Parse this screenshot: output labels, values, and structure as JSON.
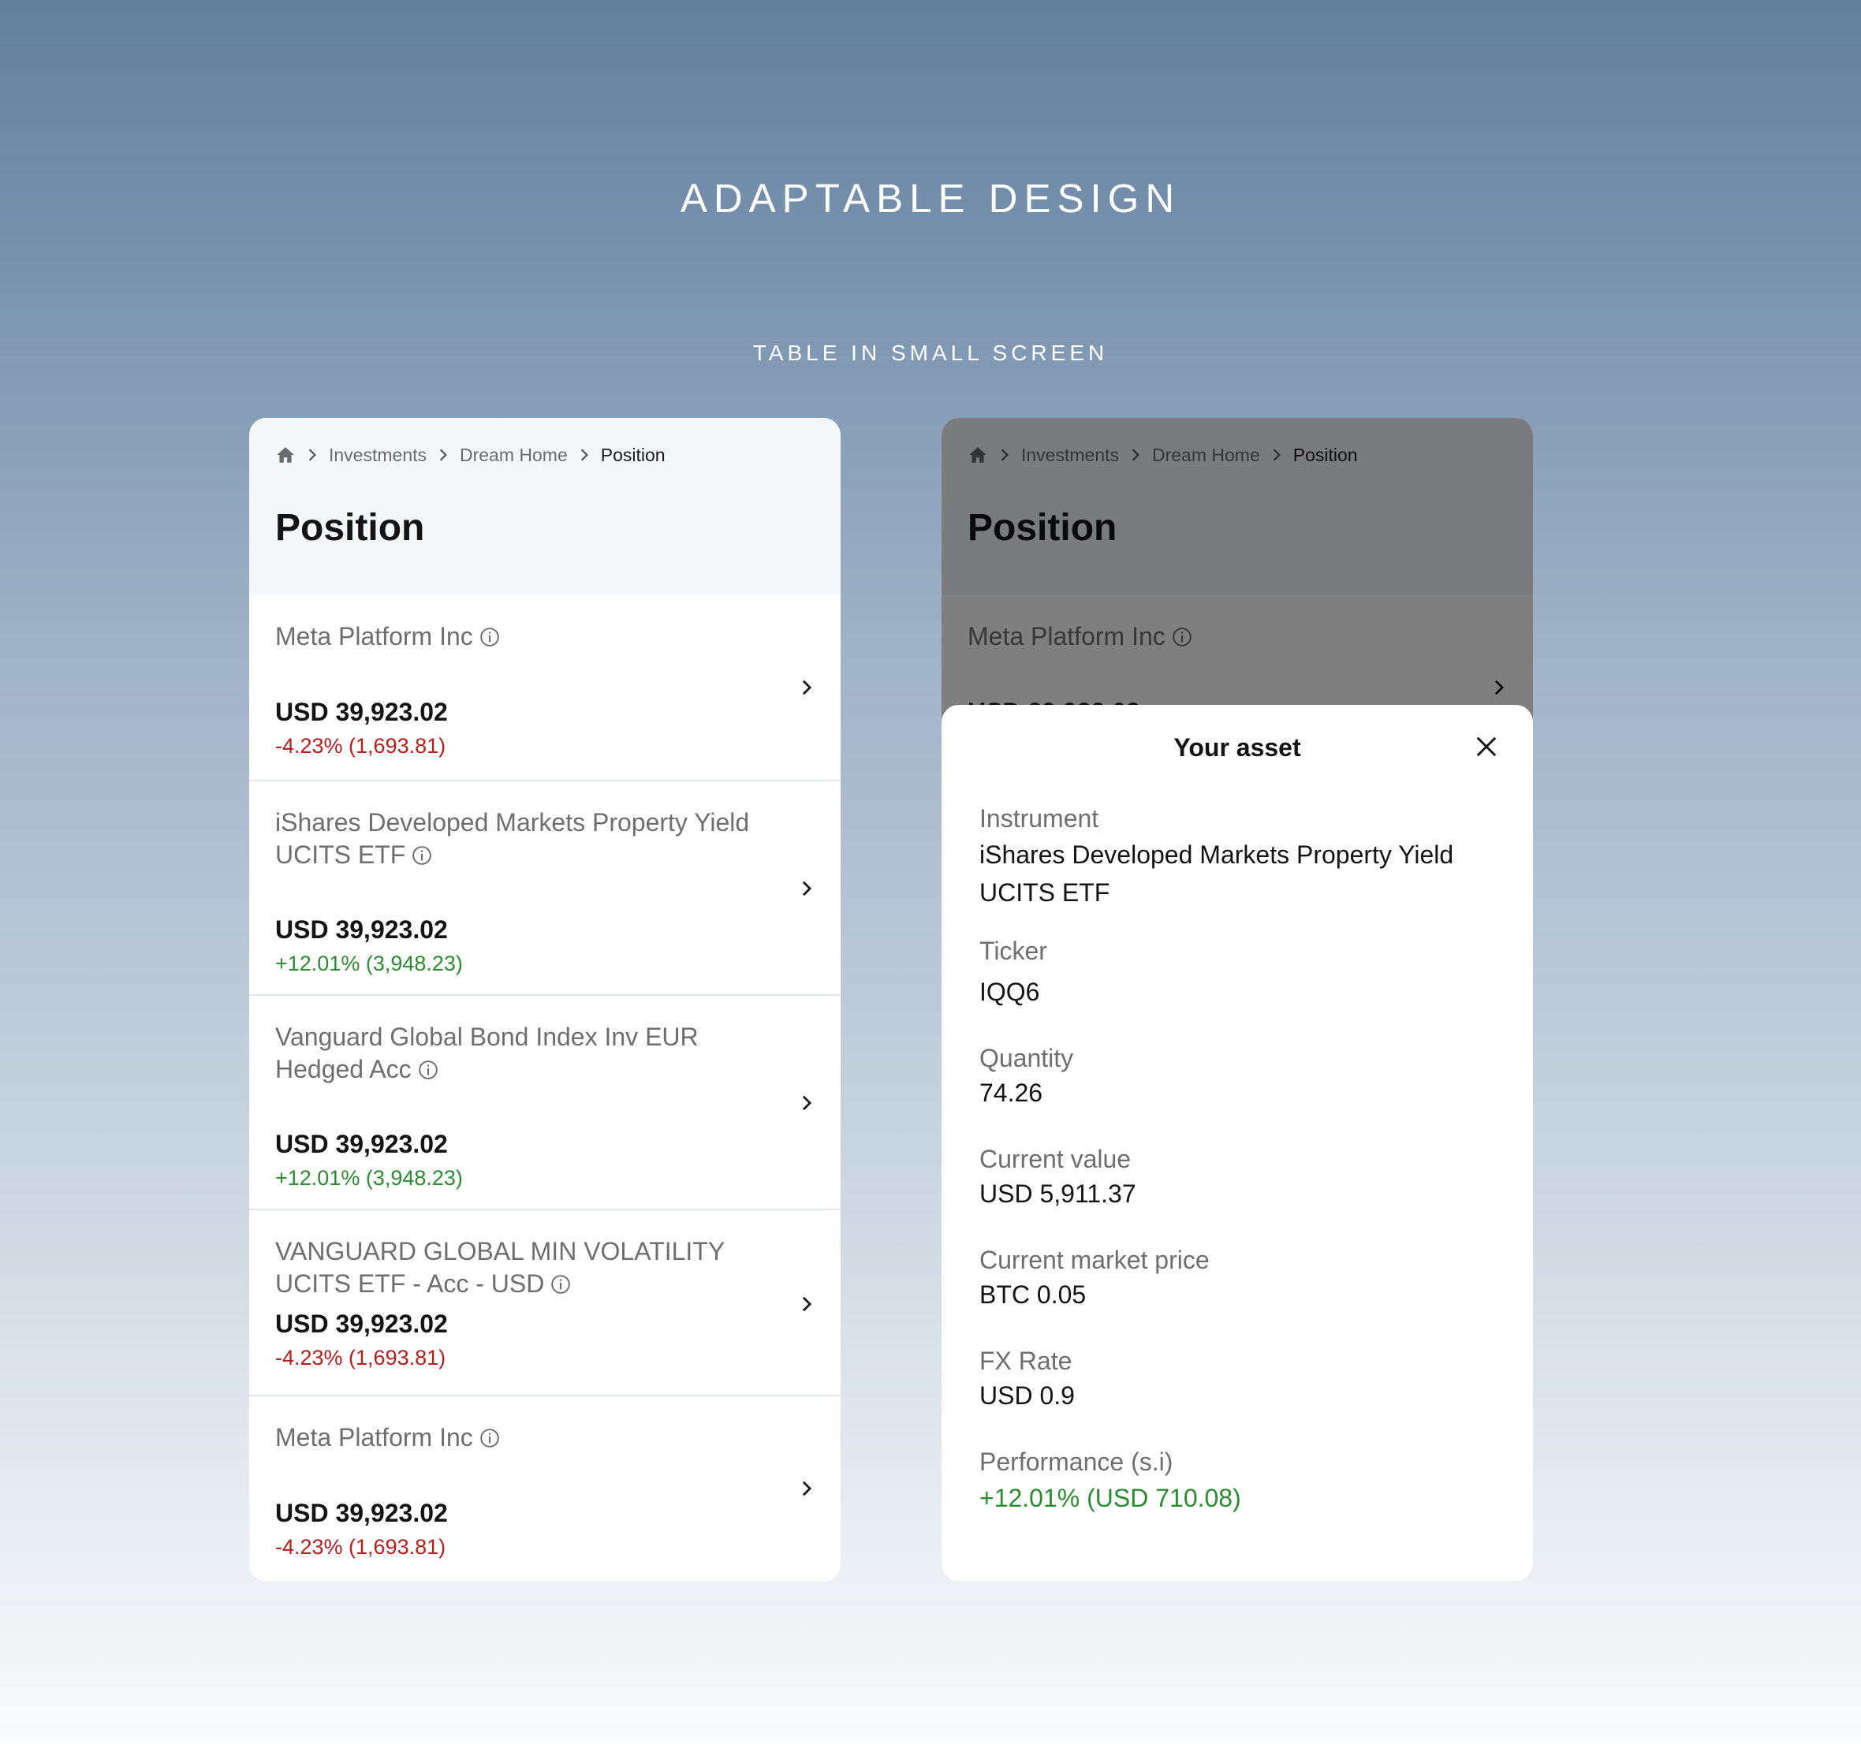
{
  "header": {
    "title": "ADAPTABLE DESIGN",
    "subtitle": "TABLE IN SMALL SCREEN"
  },
  "breadcrumb": {
    "items": [
      "Investments",
      "Dream Home"
    ],
    "current": "Position"
  },
  "page_title": "Position",
  "positions": [
    {
      "name": "Meta Platform Inc",
      "value": "USD 39,923.02",
      "change": "-4.23% (1,693.81)",
      "trend": "negative"
    },
    {
      "name": "iShares Developed Markets Property Yield UCITS ETF",
      "value": "USD 39,923.02",
      "change": "+12.01% (3,948.23)",
      "trend": "positive"
    },
    {
      "name": "Vanguard Global Bond Index Inv EUR Hedged Acc",
      "value": "USD 39,923.02",
      "change": "+12.01% (3,948.23)",
      "trend": "positive"
    },
    {
      "name": "VANGUARD GLOBAL MIN VOLATILITY UCITS ETF - Acc - USD",
      "value": "USD 39,923.02",
      "change": "-4.23% (1,693.81)",
      "trend": "negative"
    },
    {
      "name": "Meta Platform Inc",
      "value": "USD 39,923.02",
      "change": "-4.23% (1,693.81)",
      "trend": "negative"
    }
  ],
  "detail": {
    "title": "Your asset",
    "fields": [
      {
        "label": "Instrument",
        "value": "iShares Developed Markets Property Yield UCITS ETF"
      },
      {
        "label": "Ticker",
        "value": "IQQ6"
      },
      {
        "label": "Quantity",
        "value": "74.26"
      },
      {
        "label": "Current value",
        "value": "USD 5,911.37"
      },
      {
        "label": "Current market price",
        "value": "BTC 0.05"
      },
      {
        "label": "FX Rate",
        "value": "USD 0.9"
      },
      {
        "label": "Performance (s.i)",
        "value": "+12.01% (USD 710.08)"
      }
    ]
  },
  "colors": {
    "negative": "#b3201d",
    "positive": "#2e8b34",
    "card_header": "#f3f7fa"
  },
  "icons": [
    "home-icon",
    "chevron-right-icon",
    "info-icon",
    "close-icon"
  ]
}
